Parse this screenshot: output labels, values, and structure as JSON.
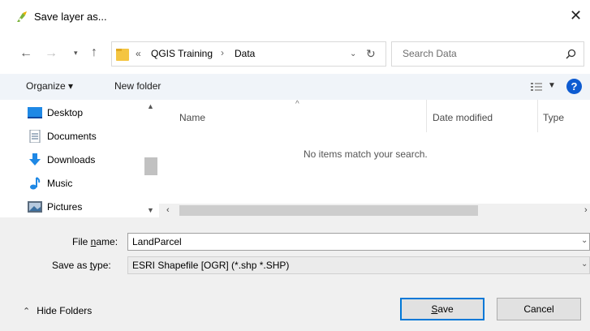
{
  "window": {
    "title": "Save layer as...",
    "close_glyph": "✕"
  },
  "address": {
    "overflow": "«",
    "crumbs": [
      "QGIS Training",
      "Data"
    ],
    "separator": "›",
    "search_placeholder": "Search Data"
  },
  "toolbar": {
    "organize_label": "Organize ▾",
    "new_folder_label": "New folder"
  },
  "nav": {
    "items": [
      {
        "label": "Desktop",
        "icon": "desktop-icon"
      },
      {
        "label": "Documents",
        "icon": "documents-icon"
      },
      {
        "label": "Downloads",
        "icon": "downloads-icon"
      },
      {
        "label": "Music",
        "icon": "music-icon"
      },
      {
        "label": "Pictures",
        "icon": "pictures-icon"
      }
    ]
  },
  "files": {
    "columns": [
      "Name",
      "Date modified",
      "Type"
    ],
    "empty_message": "No items match your search."
  },
  "form": {
    "filename_label_pre": "File ",
    "filename_label_u": "n",
    "filename_label_post": "ame:",
    "filename_value": "LandParcel",
    "savetype_label_pre": "Save as ",
    "savetype_label_u": "t",
    "savetype_label_post": "ype:",
    "savetype_value": "ESRI Shapefile [OGR] (*.shp *.SHP)"
  },
  "footer": {
    "hide_folders_label": "Hide Folders",
    "save_label_u": "S",
    "save_label_post": "ave",
    "cancel_label": "Cancel"
  },
  "colors": {
    "accent": "#0078d7",
    "folder": "#f4c542"
  }
}
